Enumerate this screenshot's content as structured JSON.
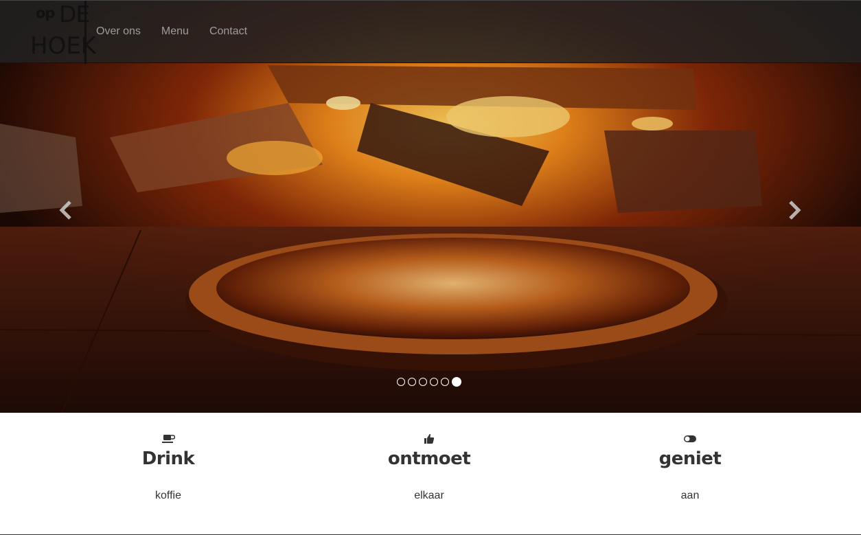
{
  "brand": {
    "logo_line1": "op",
    "logo_line2": "DE",
    "logo_line3": "HOEK"
  },
  "nav": {
    "items": [
      {
        "label": "Over ons"
      },
      {
        "label": "Menu"
      },
      {
        "label": "Contact"
      }
    ]
  },
  "carousel": {
    "slide_count": 6,
    "active_index": 5
  },
  "features": [
    {
      "icon": "coffee-cup-icon",
      "title": "Drink",
      "text": "koffie"
    },
    {
      "icon": "thumbs-up-icon",
      "title": "ontmoet",
      "text": "elkaar"
    },
    {
      "icon": "toggle-icon",
      "title": "geniet",
      "text": "aan"
    }
  ],
  "colors": {
    "navbar_bg": "#222222",
    "nav_link": "#9d9d9d",
    "heading": "#333333"
  }
}
